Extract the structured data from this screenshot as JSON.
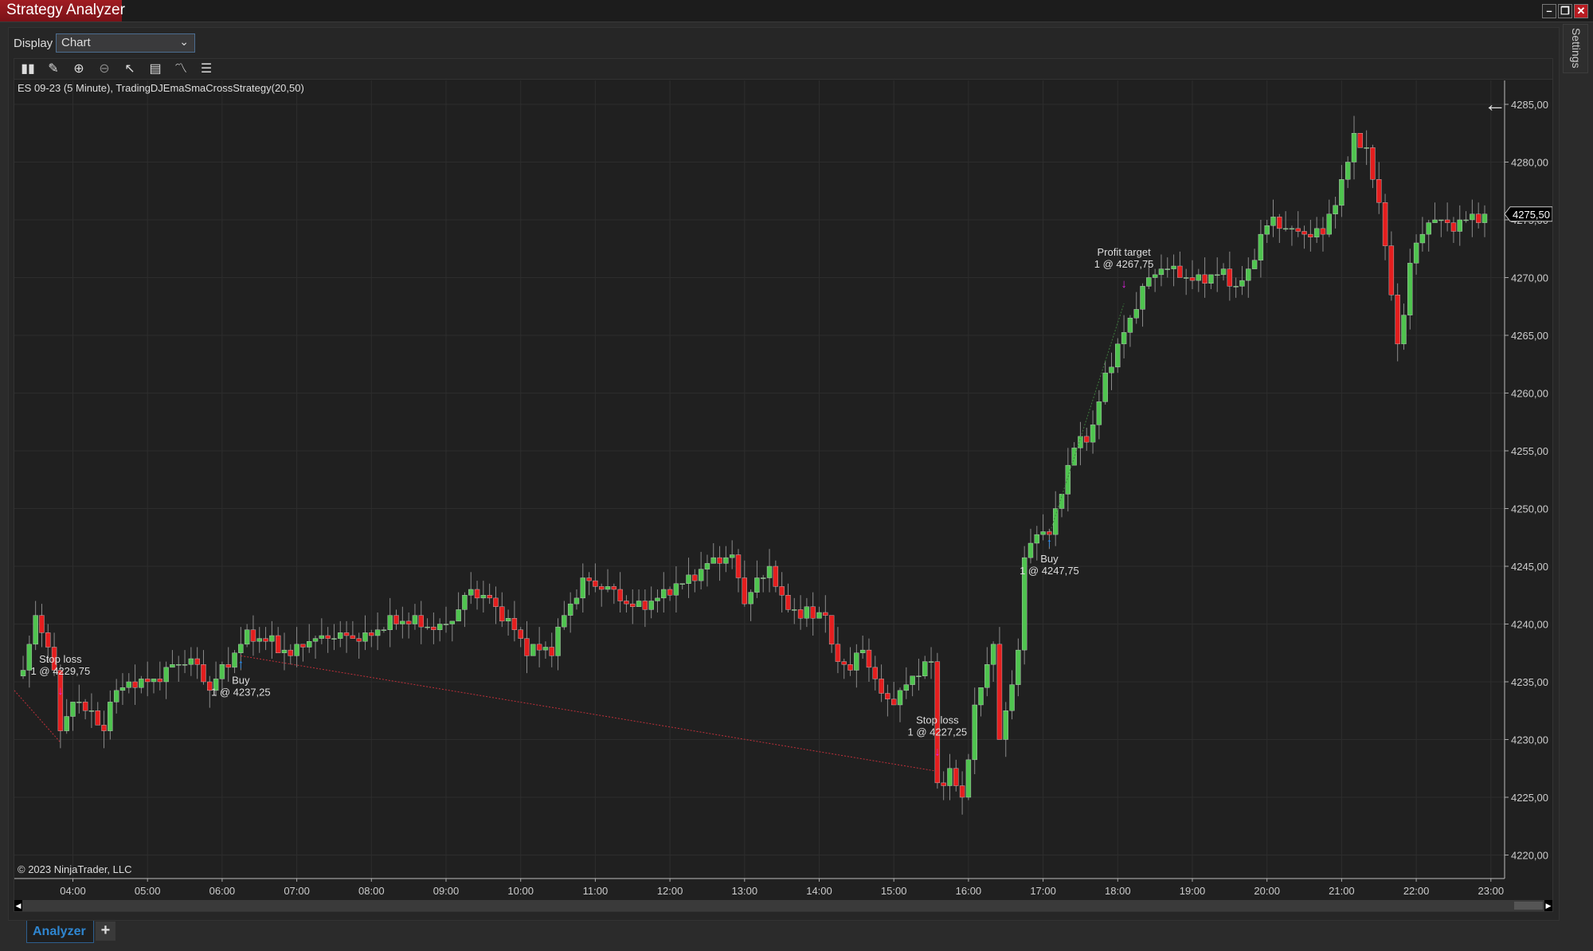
{
  "window": {
    "title": "Strategy Analyzer",
    "buttons": [
      "minimize",
      "restore",
      "close"
    ],
    "accent": "#9a1a20"
  },
  "display": {
    "label": "Display",
    "value": "Chart"
  },
  "toolbar": {
    "icons": [
      "bar-type-icon",
      "draw-pencil-icon",
      "zoom-in-icon",
      "zoom-out-icon",
      "pointer-icon",
      "data-box-icon",
      "indicators-icon",
      "strategies-list-icon"
    ]
  },
  "chart": {
    "series_label": "ES 09-23 (5 Minute), TradingDJEmaSmaCrossStrategy(20,50)",
    "copyright": "© 2023 NinjaTrader, LLC",
    "current_price": "4275,50",
    "price_ticks": [
      "4285,00",
      "4280,00",
      "4275,00",
      "4270,00",
      "4265,00",
      "4260,00",
      "4255,00",
      "4250,00",
      "4245,00",
      "4240,00",
      "4235,00",
      "4230,00",
      "4225,00",
      "4220,00"
    ],
    "time_ticks": [
      "04:00",
      "05:00",
      "06:00",
      "07:00",
      "08:00",
      "09:00",
      "10:00",
      "11:00",
      "12:00",
      "13:00",
      "14:00",
      "15:00",
      "16:00",
      "17:00",
      "18:00",
      "19:00",
      "20:00",
      "21:00",
      "22:00",
      "23:00"
    ],
    "colors": {
      "up": "#4fc44f",
      "down": "#e41e1e",
      "wick": "#8a8a8a",
      "background": "#202020",
      "buy": "#1e8fff",
      "exit": "#e020e0",
      "trade_line": "#c0303a"
    },
    "price_path": [
      [
        "03:20",
        4235.5
      ],
      [
        "03:30",
        4241
      ],
      [
        "03:45",
        4236
      ],
      [
        "03:50",
        4231
      ],
      [
        "04:00",
        4233
      ],
      [
        "04:10",
        4233
      ],
      [
        "04:25",
        4230.5
      ],
      [
        "04:30",
        4233.75
      ],
      [
        "04:50",
        4235
      ],
      [
        "05:05",
        4235
      ],
      [
        "05:15",
        4236
      ],
      [
        "05:35",
        4237
      ],
      [
        "05:50",
        4234.5
      ],
      [
        "06:05",
        4236.75
      ],
      [
        "06:20",
        4239
      ],
      [
        "06:40",
        4238.5
      ],
      [
        "06:55",
        4237.25
      ],
      [
        "07:05",
        4238.5
      ],
      [
        "07:30",
        4239
      ],
      [
        "07:55",
        4238.75
      ],
      [
        "08:15",
        4240.25
      ],
      [
        "08:35",
        4240.25
      ],
      [
        "08:55",
        4239.5
      ],
      [
        "09:05",
        4240.5
      ],
      [
        "09:20",
        4243
      ],
      [
        "09:35",
        4242
      ],
      [
        "09:50",
        4240.25
      ],
      [
        "10:05",
        4237.75
      ],
      [
        "10:25",
        4237.75
      ],
      [
        "10:35",
        4240.75
      ],
      [
        "10:50",
        4243.75
      ],
      [
        "11:10",
        4243
      ],
      [
        "11:30",
        4241.5
      ],
      [
        "11:45",
        4242
      ],
      [
        "12:00",
        4243
      ],
      [
        "12:15",
        4243.75
      ],
      [
        "12:35",
        4245.5
      ],
      [
        "12:50",
        4245.75
      ],
      [
        "13:00",
        4242
      ],
      [
        "13:20",
        4245
      ],
      [
        "13:30",
        4242
      ],
      [
        "13:45",
        4240.75
      ],
      [
        "14:05",
        4241
      ],
      [
        "14:10",
        4237.75
      ],
      [
        "14:25",
        4236
      ],
      [
        "14:35",
        4238
      ],
      [
        "14:50",
        4233.75
      ],
      [
        "15:00",
        4233.25
      ],
      [
        "15:15",
        4235.5
      ],
      [
        "15:30",
        4236.75
      ],
      [
        "15:35",
        4226.25
      ],
      [
        "15:45",
        4227
      ],
      [
        "15:55",
        4225
      ],
      [
        "16:05",
        4232.5
      ],
      [
        "16:20",
        4238.5
      ],
      [
        "16:25",
        4229.75
      ],
      [
        "16:40",
        4237.75
      ],
      [
        "16:45",
        4245.5
      ],
      [
        "16:55",
        4248.25
      ],
      [
        "17:05",
        4247.75
      ],
      [
        "17:15",
        4251.75
      ],
      [
        "17:25",
        4255.25
      ],
      [
        "17:40",
        4257
      ],
      [
        "17:50",
        4261.5
      ],
      [
        "18:00",
        4264
      ],
      [
        "18:10",
        4266.25
      ],
      [
        "18:20",
        4269.25
      ],
      [
        "18:35",
        4271
      ],
      [
        "18:50",
        4270.25
      ],
      [
        "19:05",
        4269.75
      ],
      [
        "19:20",
        4270.5
      ],
      [
        "19:35",
        4269.25
      ],
      [
        "19:45",
        4270.25
      ],
      [
        "19:55",
        4273.75
      ],
      [
        "20:05",
        4275
      ],
      [
        "20:20",
        4274
      ],
      [
        "20:35",
        4273.75
      ],
      [
        "20:45",
        4273.75
      ],
      [
        "20:50",
        4275.5
      ],
      [
        "21:00",
        4278
      ],
      [
        "21:10",
        4282.5
      ],
      [
        "21:20",
        4280.75
      ],
      [
        "21:30",
        4276.5
      ],
      [
        "21:35",
        4273
      ],
      [
        "21:40",
        4268
      ],
      [
        "21:45",
        4264.5
      ],
      [
        "21:50",
        4266.75
      ],
      [
        "21:55",
        4271.5
      ],
      [
        "22:05",
        4273.75
      ],
      [
        "22:10",
        4275
      ],
      [
        "22:30",
        4274.5
      ],
      [
        "22:45",
        4275.25
      ],
      [
        "22:55",
        4275.5
      ]
    ],
    "executions": [
      {
        "type": "exit",
        "title": "Stop loss",
        "detail": "1 @ 4229,75",
        "time": "03:50",
        "price": 4229.75
      },
      {
        "type": "buy",
        "title": "Buy",
        "detail": "1 @ 4237,25",
        "time": "06:15",
        "price": 4237.25
      },
      {
        "type": "exit",
        "title": "Stop loss",
        "detail": "1 @ 4227,25",
        "time": "15:35",
        "price": 4227.25
      },
      {
        "type": "buy",
        "title": "Buy",
        "detail": "1 @ 4247,75",
        "time": "17:05",
        "price": 4247.75
      },
      {
        "type": "exit",
        "title": "Profit target",
        "detail": "1 @ 4267,75",
        "time": "18:05",
        "price": 4267.75
      }
    ]
  },
  "tabs": {
    "active": "Analyzer",
    "add": "+"
  },
  "side_panel": {
    "label": "Settings"
  }
}
